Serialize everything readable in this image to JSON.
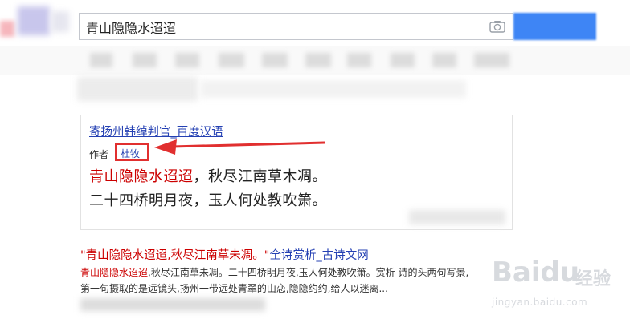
{
  "search": {
    "query": "青山隐隐水迢迢"
  },
  "result_card": {
    "title": "寄扬州韩绰判官_百度汉语",
    "author_label": "作者",
    "author": "杜牧",
    "poem_line1_highlight": "青山隐隐水迢迢",
    "poem_line1_rest": "，秋尽江南草木凋。",
    "poem_line2": "二十四桥明月夜，玉人何处教吹箫。"
  },
  "result2": {
    "title_highlight": "\"青山隐隐水迢迢,秋尽江南草未凋。\"",
    "title_rest": "全诗赏析_古诗文网",
    "snippet1_highlight": "青山隐隐水迢迢",
    "snippet1_rest": ",秋尽江南草未凋。二十四桥明月夜,玉人何处教吹箫。赏析 诗的头两句写景,",
    "snippet2": "第一句摄取的是远镜头,扬州一带远处青翠的山恋,隐隐约约,给人以迷离..."
  },
  "watermark": {
    "logo": "Baidu",
    "cn": "经验",
    "url": "jingyan.baidu.com"
  },
  "colors": {
    "link": "#2440b3",
    "highlight": "#cc0000",
    "annotation_red": "#e12f2f",
    "search_button": "#3e85f5"
  },
  "icons": [
    "camera-icon",
    "arrow-annotation"
  ]
}
